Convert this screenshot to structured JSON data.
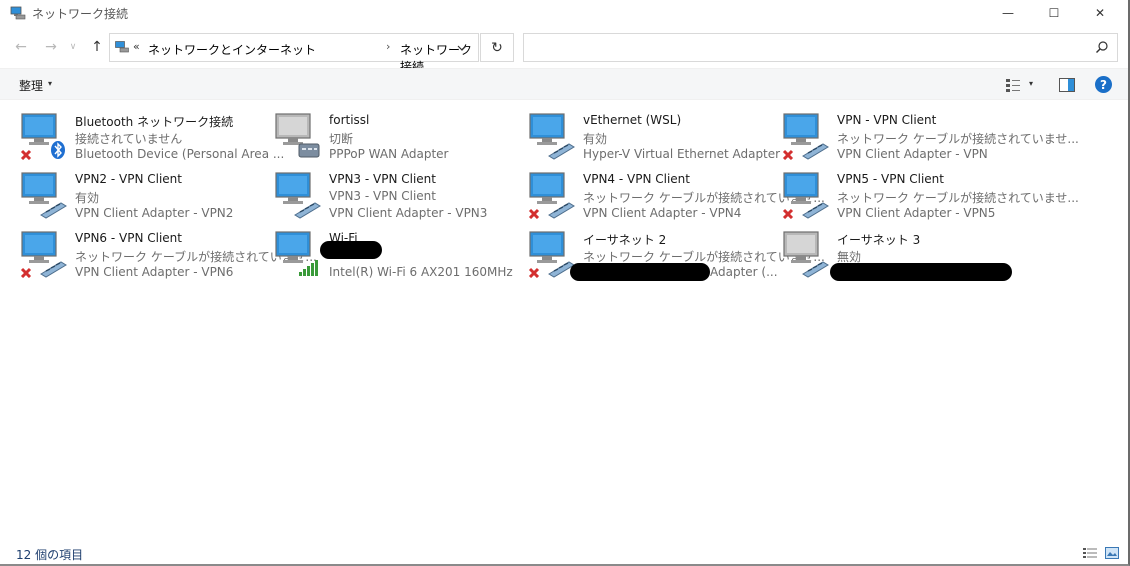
{
  "window": {
    "title": "ネットワーク接続",
    "controls": {
      "minimize": "—",
      "maximize": "☐",
      "close": "✕"
    }
  },
  "nav": {
    "back": "←",
    "forward": "→",
    "recent": "∨",
    "up": "↑",
    "breadcrumb_chevron": "«",
    "breadcrumb": [
      "ネットワークとインターネット",
      "ネットワーク接続"
    ],
    "breadcrumb_separator": "›",
    "dropdown": "⌄",
    "refresh": "↻",
    "search_placeholder": ""
  },
  "commandbar": {
    "organize_label": "整理",
    "dropdown_arrow": "▾",
    "help_label": "?"
  },
  "connections": [
    {
      "name": "Bluetooth ネットワーク接続",
      "status": "接続されていません",
      "device": "Bluetooth Device (Personal Area ...",
      "icon": "bluetooth-adapter-icon",
      "overlay": "red-x"
    },
    {
      "name": "fortissl",
      "status": "切断",
      "device": "PPPoP WAN Adapter",
      "icon": "wan-adapter-icon",
      "overlay": "none"
    },
    {
      "name": "vEthernet (WSL)",
      "status": "有効",
      "device": "Hyper-V Virtual Ethernet Adapter",
      "icon": "ethernet-adapter-icon",
      "overlay": "none"
    },
    {
      "name": "VPN - VPN Client",
      "status": "ネットワーク ケーブルが接続されていませ...",
      "device": "VPN Client Adapter - VPN",
      "icon": "ethernet-adapter-icon",
      "overlay": "red-x"
    },
    {
      "name": "VPN2 - VPN Client",
      "status": "有効",
      "device": "VPN Client Adapter - VPN2",
      "icon": "ethernet-adapter-icon",
      "overlay": "none"
    },
    {
      "name": "VPN3 - VPN Client",
      "status": "VPN3 - VPN Client",
      "device": "VPN Client Adapter - VPN3",
      "icon": "ethernet-adapter-icon",
      "overlay": "none"
    },
    {
      "name": "VPN4 - VPN Client",
      "status": "ネットワーク ケーブルが接続されていませ...",
      "device": "VPN Client Adapter - VPN4",
      "icon": "ethernet-adapter-icon",
      "overlay": "red-x"
    },
    {
      "name": "VPN5 - VPN Client",
      "status": "ネットワーク ケーブルが接続されていませ...",
      "device": "VPN Client Adapter - VPN5",
      "icon": "ethernet-adapter-icon",
      "overlay": "red-x"
    },
    {
      "name": "VPN6 - VPN Client",
      "status": "ネットワーク ケーブルが接続されていませ...",
      "device": "VPN Client Adapter - VPN6",
      "icon": "ethernet-adapter-icon",
      "overlay": "red-x"
    },
    {
      "name": "Wi-Fi",
      "status": "",
      "device": "Intel(R) Wi-Fi 6 AX201 160MHz",
      "icon": "wifi-adapter-icon",
      "overlay": "signal"
    },
    {
      "name": "イーサネット 2",
      "status": "ネットワーク ケーブルが接続されていませ...",
      "device": "Adapter (...",
      "icon": "ethernet-adapter-icon",
      "overlay": "red-x"
    },
    {
      "name": "イーサネット 3",
      "status": "無効",
      "device": "",
      "icon": "ethernet-adapter-disabled-icon",
      "overlay": "none"
    }
  ],
  "statusbar": {
    "item_count": "12 個の項目"
  },
  "colors": {
    "accent": "#1a6fc8",
    "monitor_blue": "#2f8fd8",
    "error_red": "#d32f2f",
    "signal_green": "#3a9a3a"
  }
}
